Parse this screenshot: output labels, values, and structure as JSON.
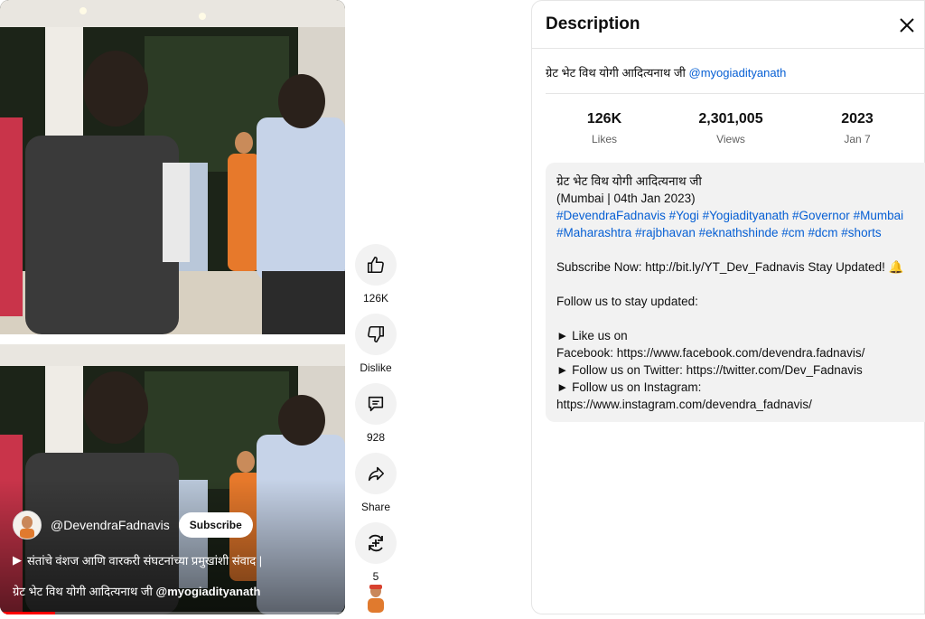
{
  "video": {
    "channel_handle": "@DevendraFadnavis",
    "subscribe_label": "Subscribe",
    "promo_icon": "▶",
    "promo_text": "संतांचे वंशज आणि वारकरी संघटनांच्या प्रमुखांशी संवाद |",
    "caption_text": "ग्रेट भेट विथ योगी आदित्यनाथ जी",
    "caption_handle": "@myogiadityanath",
    "progress": 0.16
  },
  "actions": [
    {
      "name": "like-button",
      "icon": "thumbs-up-icon",
      "label": "126K"
    },
    {
      "name": "dislike-button",
      "icon": "thumbs-down-icon",
      "label": "Dislike"
    },
    {
      "name": "comments-button",
      "icon": "comment-icon",
      "label": "928"
    },
    {
      "name": "share-button",
      "icon": "share-icon",
      "label": "Share"
    },
    {
      "name": "remix-button",
      "icon": "remix-icon",
      "label": "5"
    }
  ],
  "description": {
    "title": "Description",
    "headline_text": "ग्रेट भेट विथ योगी आदित्यनाथ जी",
    "headline_handle": "@myogiadityanath",
    "stats": [
      {
        "value": "126K",
        "label": "Likes"
      },
      {
        "value": "2,301,005",
        "label": "Views"
      },
      {
        "value": "2023",
        "label": "Jan 7"
      }
    ],
    "body": {
      "line1": "ग्रेट भेट विथ योगी आदित्यनाथ जी",
      "line2": "(Mumbai | 04th Jan 2023)",
      "hashtags_line1": [
        "#DevendraFadnavis",
        "#Yogi",
        "#Yogiadityanath",
        "#Governor",
        "#Mumbai"
      ],
      "hashtags_line2": [
        "#Maharashtra",
        "#rajbhavan",
        "#eknathshinde",
        "#cm",
        "#dcm",
        "#shorts"
      ],
      "subscribe_line": "Subscribe Now:  http://bit.ly/YT_Dev_Fadnavis Stay Updated! 🔔",
      "follow_heading": "Follow us to stay updated:",
      "like_line": "► Like us on",
      "facebook_line": "Facebook: https://www.facebook.com/devendra.fadnavis/",
      "twitter_line": "► Follow us on Twitter: https://twitter.com/Dev_Fadnavis",
      "instagram_label": "► Follow us on Instagram:",
      "instagram_url": "https://www.instagram.com/devendra_fadnavis/"
    }
  },
  "colors": {
    "accent_link": "#065fd4",
    "progress": "#ff0000"
  }
}
